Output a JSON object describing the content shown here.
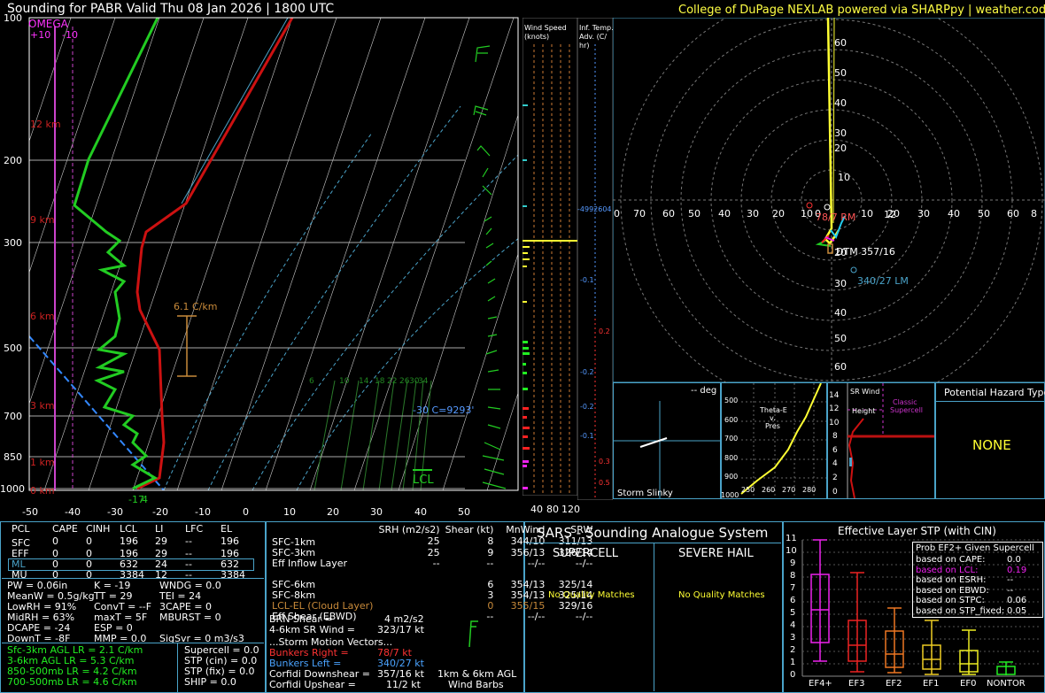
{
  "header": {
    "title": "Sounding for PABR Valid  Thu 08 Jan 2026 | 1800 UTC",
    "credit": "College of DuPage NEXLAB powered via SHARPpy | weather.cod.edu"
  },
  "skewt": {
    "omega_label": "OMEGA",
    "omega_plus": "+10",
    "omega_minus": "-10",
    "pressure_ticks": [
      "100",
      "200",
      "300",
      "500",
      "700",
      "850",
      "1000"
    ],
    "temp_ticks": [
      "-50",
      "-40",
      "-30",
      "-20",
      "-10",
      "0",
      "10",
      "20",
      "30",
      "40",
      "50"
    ],
    "height_labels": [
      "12 km",
      "9 km",
      "6 km",
      "3 km",
      "1 km",
      "0 km"
    ],
    "lapse_label": "6.1 C/km",
    "mixing_ratios": [
      "6",
      "10",
      "14",
      "18",
      "22",
      "26",
      "30",
      "34"
    ],
    "wb_label": "-30 C=9293'",
    "lcl_label": "LCL",
    "sfc_temp": "-17",
    "sfc_dew": "4",
    "colors": {
      "temp": "#cc1111",
      "dew": "#22cc22",
      "isobar": "#aaaaaa",
      "dry_adiabat": "#ffffff",
      "moist_adiabat": "#4aa3c9",
      "mixing": "#226622"
    }
  },
  "wind_col": {
    "label1": "Wind Speed",
    "label2": "(knots)",
    "axis": [
      "40",
      "80",
      "120"
    ]
  },
  "inf_col": {
    "label1": "Inf. Temp.",
    "label2": "Adv. (C/",
    "label3": "hr)",
    "top_value": "-4992604",
    "values": [
      "-0.1",
      "0.2",
      "-0.2",
      "-0.2",
      "-0.1",
      "0.3",
      "0.5"
    ]
  },
  "hodo": {
    "x_ticks": [
      "0",
      "70",
      "60",
      "50",
      "40",
      "30",
      "20",
      "10",
      "0",
      "10",
      "20",
      "30",
      "40",
      "50",
      "60",
      "70",
      "8"
    ],
    "y_ticks_up": [
      "60",
      "50",
      "40",
      "30",
      "20",
      "10"
    ],
    "y_ticks_down": [
      "10",
      "20",
      "30",
      "40",
      "50",
      "60"
    ],
    "rm_label": "78/7 RM",
    "mean_label": "12",
    "dtm_label": "DTM 357/16",
    "lm_label": "340/27 LM"
  },
  "slinky": {
    "deg": "-- deg",
    "label": "Storm Slinky"
  },
  "theta": {
    "label1": "Theta-E",
    "label2": "v.",
    "label3": "Pres",
    "p_ticks": [
      "500",
      "600",
      "700",
      "800",
      "900",
      "1000"
    ],
    "t_ticks": [
      "240",
      "250",
      "260",
      "270",
      "280"
    ]
  },
  "srwind": {
    "label1": "SR Wind",
    "label2": "Height",
    "classic1": "Classic",
    "classic2": "Supercell",
    "y_ticks": [
      "14",
      "12",
      "10",
      "8",
      "6",
      "4",
      "2",
      "0"
    ]
  },
  "hazard": {
    "title": "Potential Hazard Type",
    "value": "NONE"
  },
  "parcels": {
    "headers": [
      "PCL",
      "CAPE",
      "CINH",
      "LCL",
      "LI",
      "LFC",
      "EL"
    ],
    "rows": [
      [
        "SFC",
        "0",
        "0",
        "196",
        "29",
        "--",
        "196"
      ],
      [
        "EFF",
        "0",
        "0",
        "196",
        "29",
        "--",
        "196"
      ],
      [
        "ML",
        "0",
        "0",
        "632",
        "24",
        "--",
        "632"
      ],
      [
        "MU",
        "0",
        "0",
        "3384",
        "12",
        "--",
        "3384"
      ]
    ]
  },
  "indices": {
    "col1": [
      "PW = 0.06in",
      "MeanW = 0.5g/kg",
      "LowRH = 91%",
      "MidRH = 63%",
      "DCAPE = -24",
      "DownT = -8F"
    ],
    "col2": [
      "K = -19",
      "TT = 29",
      "ConvT = --F",
      "maxT = 5F",
      "ESP = 0",
      "MMP = 0.0"
    ],
    "col3": [
      "WNDG = 0.0",
      "TEI = 24",
      "3CAPE = 0",
      "MBURST = 0",
      "",
      "SigSvr = 0 m3/s3"
    ]
  },
  "lapse": [
    "Sfc-3km AGL LR = 2.1 C/km",
    "3-6km AGL LR = 5.3 C/km",
    "850-500mb LR = 4.2 C/km",
    "700-500mb LR = 4.6 C/km"
  ],
  "composite": [
    "Supercell = 0.0",
    "STP (cin) = 0.0",
    "STP (fix) = 0.0",
    "SHIP = 0.0"
  ],
  "kinematic": {
    "headers": [
      "SRH (m2/s2)",
      "Shear (kt)",
      "MnWind",
      "SRW"
    ],
    "rows": [
      [
        "SFC-1km",
        "25",
        "8",
        "344/10",
        "311/13"
      ],
      [
        "SFC-3km",
        "25",
        "9",
        "356/13",
        "326/14"
      ],
      [
        "Eff Inflow Layer",
        "--",
        "--",
        "--/--",
        "--/--"
      ],
      [
        "",
        "",
        "",
        "",
        ""
      ],
      [
        "SFC-6km",
        "",
        "6",
        "354/13",
        "325/14"
      ],
      [
        "SFC-8km",
        "",
        "3",
        "354/13",
        "325/14"
      ],
      [
        "LCL-EL (Cloud Layer)",
        "",
        "0",
        "355/15",
        "329/16"
      ],
      [
        "Eff Shear (EBWD)",
        "",
        "--",
        "--/--",
        "--/--"
      ]
    ],
    "brn_label": "BRN Shear =",
    "brn_value": "4 m2/s2",
    "srwind_label": "4-6km SR Wind =",
    "srwind_value": "323/17 kt",
    "storm_title": "...Storm Motion Vectors...",
    "motions": [
      [
        "Bunkers Right =",
        "78/7 kt"
      ],
      [
        "Bunkers Left =",
        "340/27 kt"
      ],
      [
        "Corfidi Downshear =",
        "357/16 kt"
      ],
      [
        "Corfidi Upshear =",
        "11/2 kt"
      ]
    ],
    "barb_label1": "1km & 6km AGL",
    "barb_label2": "Wind Barbs"
  },
  "sars": {
    "title": "SARS - Sounding Analogue System",
    "supercell": "SUPERCELL",
    "hail": "SEVERE HAIL",
    "nomatch": "No Quality Matches"
  },
  "stp": {
    "title": "Effective Layer STP (with CIN)",
    "box_title": "Prob EF2+ Given Supercell",
    "probs": [
      [
        "based on CAPE:",
        "0.0"
      ],
      [
        "based on LCL:",
        "0.19"
      ],
      [
        "based on ESRH:",
        "--"
      ],
      [
        "based on EBWD:",
        "--"
      ],
      [
        "based on STPC:",
        "0.06"
      ],
      [
        "based on STP_fixed:",
        "0.05"
      ]
    ],
    "y_ticks": [
      "0",
      "1",
      "2",
      "3",
      "4",
      "5",
      "6",
      "7",
      "8",
      "9",
      "10",
      "11"
    ],
    "categories": [
      "EF4+",
      "EF3",
      "EF2",
      "EF1",
      "EF0",
      "NONTOR"
    ]
  }
}
